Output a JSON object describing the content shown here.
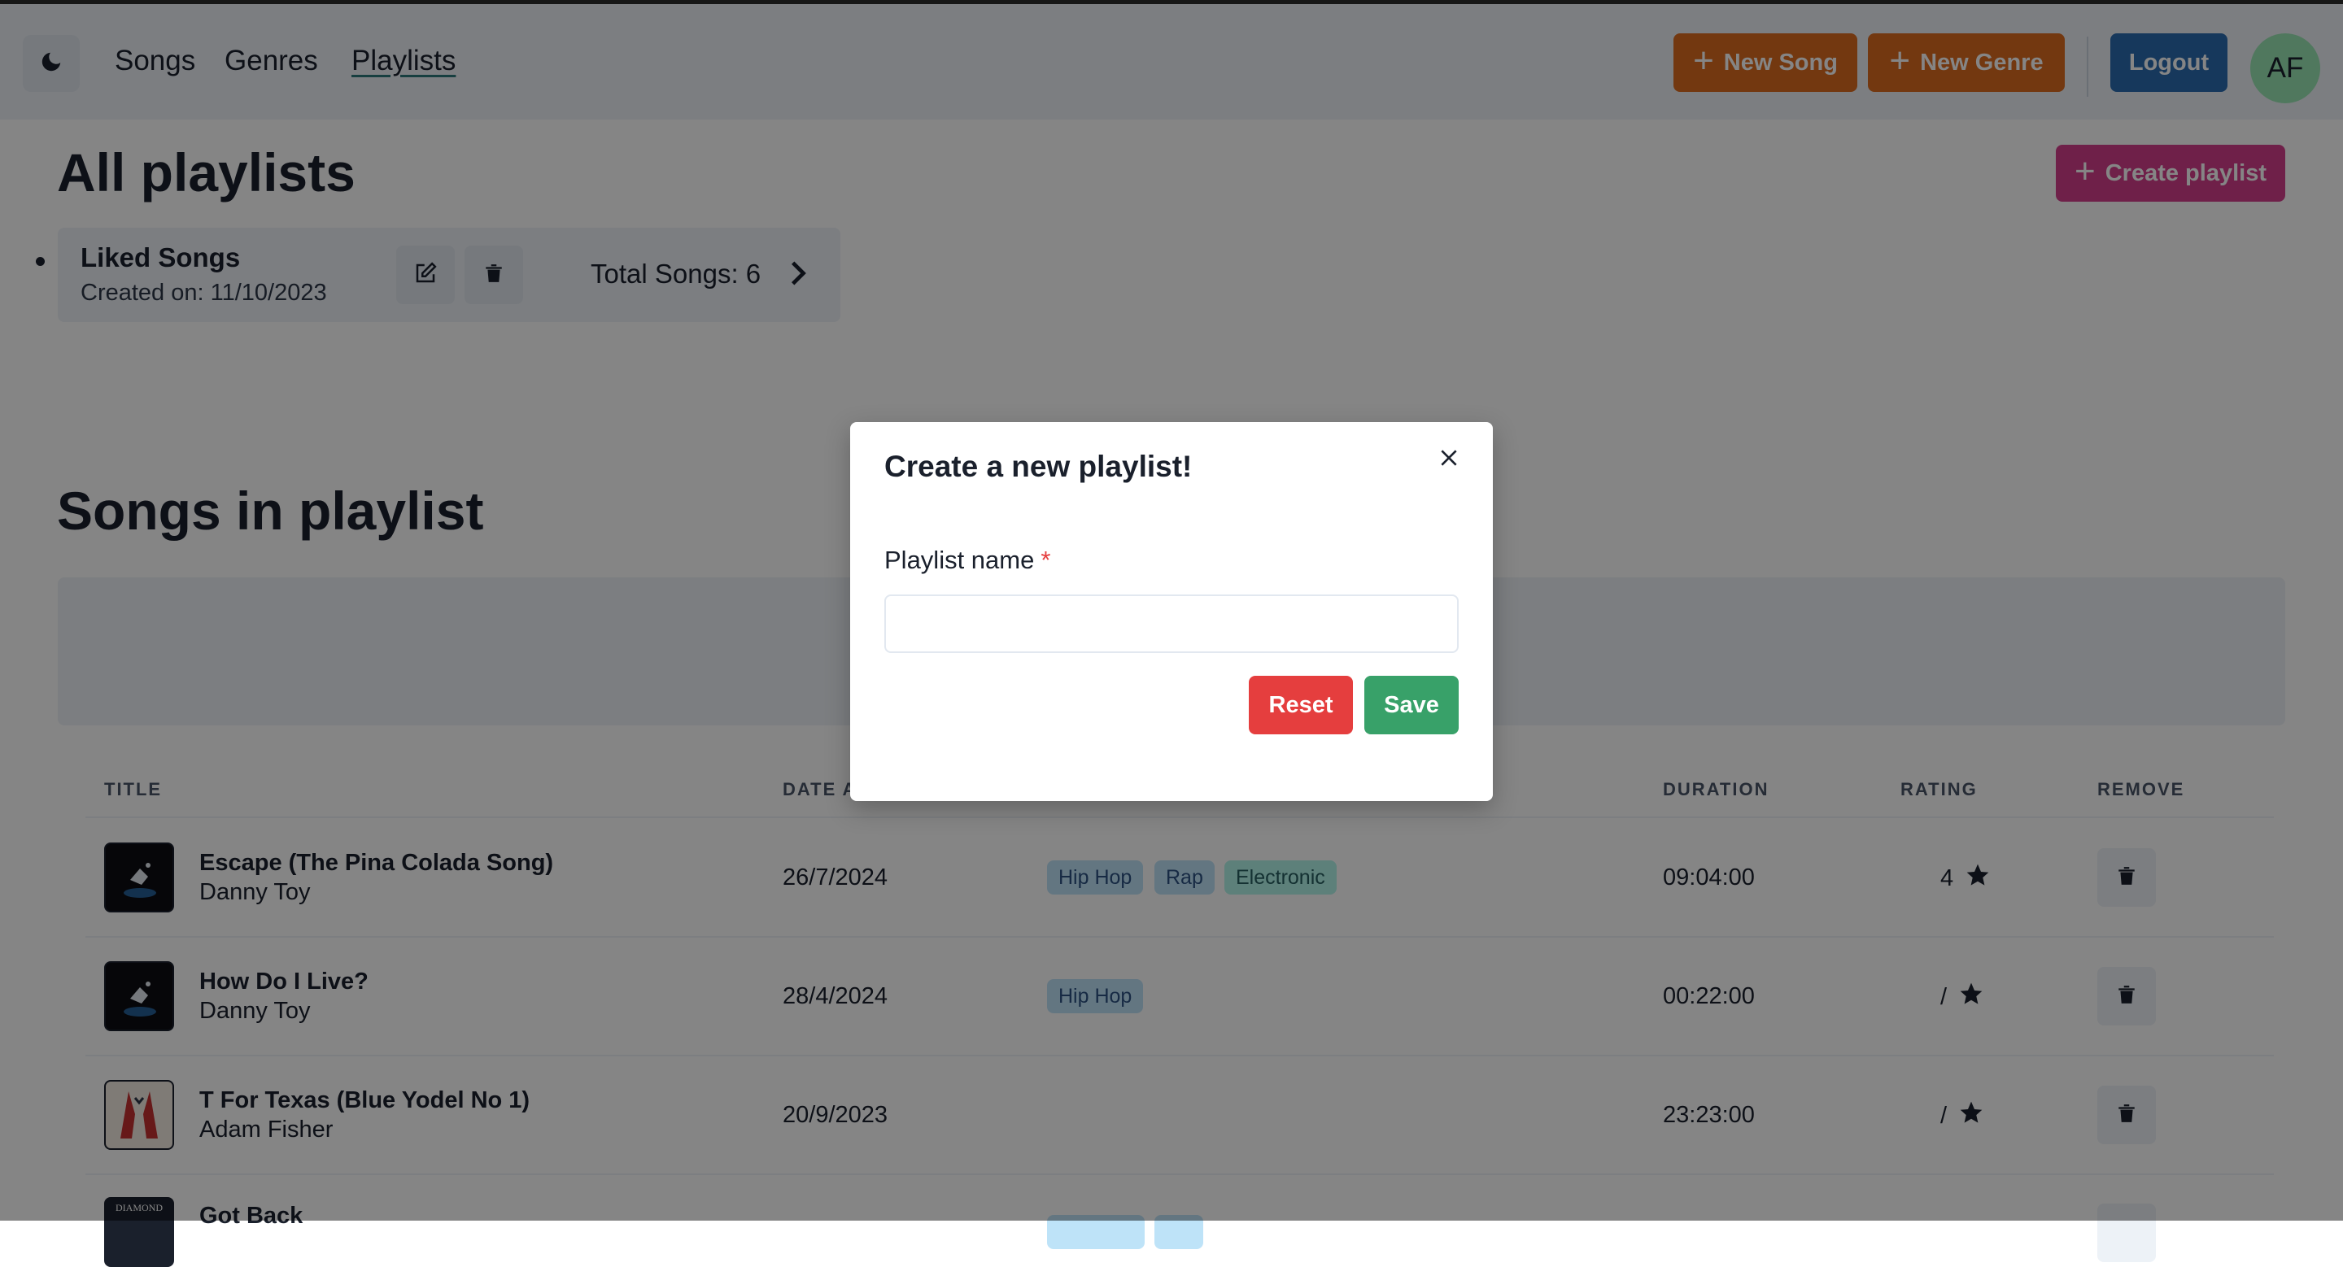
{
  "colors": {
    "accent_orange": "#dd6b20",
    "accent_blue": "#2b6cb0",
    "accent_pink": "#d53f8c",
    "reset_red": "#e53e3e",
    "save_green": "#38a169"
  },
  "nav": {
    "theme_icon": "moon-icon",
    "links": [
      "Songs",
      "Genres",
      "Playlists"
    ],
    "active_link": "Playlists",
    "new_song": "New Song",
    "new_genre": "New Genre",
    "logout": "Logout",
    "avatar_initials": "AF"
  },
  "page": {
    "title": "All playlists",
    "create_button": "Create playlist",
    "songs_section_title": "Songs in playlist"
  },
  "playlists": [
    {
      "name": "Liked Songs",
      "created": "Created on: 11/10/2023",
      "total": "Total Songs: 6"
    }
  ],
  "table": {
    "headers": {
      "title": "TITLE",
      "date": "DATE AI",
      "duration": "DURATION",
      "rating": "RATING",
      "remove": "REMOVE"
    },
    "rows": [
      {
        "title": "Escape (The Pina Colada Song)",
        "artist": "Danny Toy",
        "date": "26/7/2024",
        "genres": [
          "Hip Hop",
          "Rap",
          "Electronic"
        ],
        "duration": "09:04:00",
        "rating": "4"
      },
      {
        "title": "How Do I Live?",
        "artist": "Danny Toy",
        "date": "28/4/2024",
        "genres": [
          "Hip Hop"
        ],
        "duration": "00:22:00",
        "rating": "/"
      },
      {
        "title": "T For Texas (Blue Yodel No 1)",
        "artist": "Adam Fisher",
        "date": "20/9/2023",
        "genres": [],
        "duration": "23:23:00",
        "rating": "/"
      },
      {
        "title": "Got Back",
        "artist": "",
        "date": "",
        "genres": [],
        "duration": "",
        "rating": "",
        "thumb_text": "DIAMOND"
      }
    ]
  },
  "modal": {
    "title": "Create a new playlist!",
    "field_label": "Playlist name",
    "required_mark": "*",
    "input_value": "",
    "reset": "Reset",
    "save": "Save"
  }
}
